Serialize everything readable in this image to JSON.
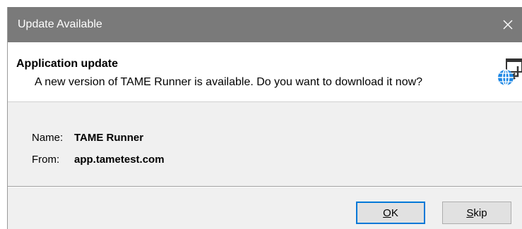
{
  "window": {
    "title": "Update Available",
    "close_glyph": "✕"
  },
  "header": {
    "title": "Application update",
    "message": "A new version of TAME Runner is available. Do you want to download it now?",
    "icon": "globe-update-icon"
  },
  "info": {
    "name_label": "Name:",
    "name_value": "TAME Runner",
    "from_label": "From:",
    "from_value": "app.tametest.com"
  },
  "buttons": {
    "ok_label": "OK",
    "skip_label": "Skip"
  },
  "colors": {
    "titlebar": "#7a7a7a",
    "accent": "#0078d7",
    "dialog_bg": "#f0f0f0"
  }
}
